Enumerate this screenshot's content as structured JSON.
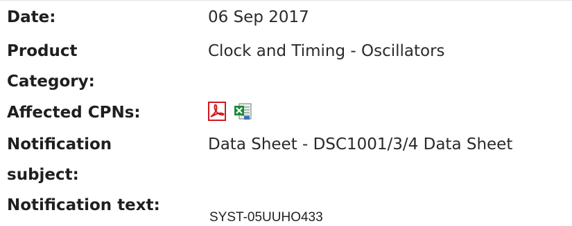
{
  "fields": {
    "date": {
      "label": "Date:",
      "value": "06 Sep 2017"
    },
    "product_category": {
      "label_line1": "Product",
      "label_line2": "Category:",
      "value": "Clock and Timing - Oscillators"
    },
    "affected_cpns": {
      "label": "Affected CPNs:",
      "icons": [
        "pdf-icon",
        "excel-icon"
      ],
      "pdf_color": "#d4161c",
      "excel_color": "#1f8a3b"
    },
    "notification_subject": {
      "label_line1": "Notification",
      "label_line2": "subject:",
      "value": "Data Sheet - DSC1001/3/4 Data Sheet"
    },
    "notification_text": {
      "label": "Notification text:",
      "value": "SYST-05UUHO433"
    }
  }
}
